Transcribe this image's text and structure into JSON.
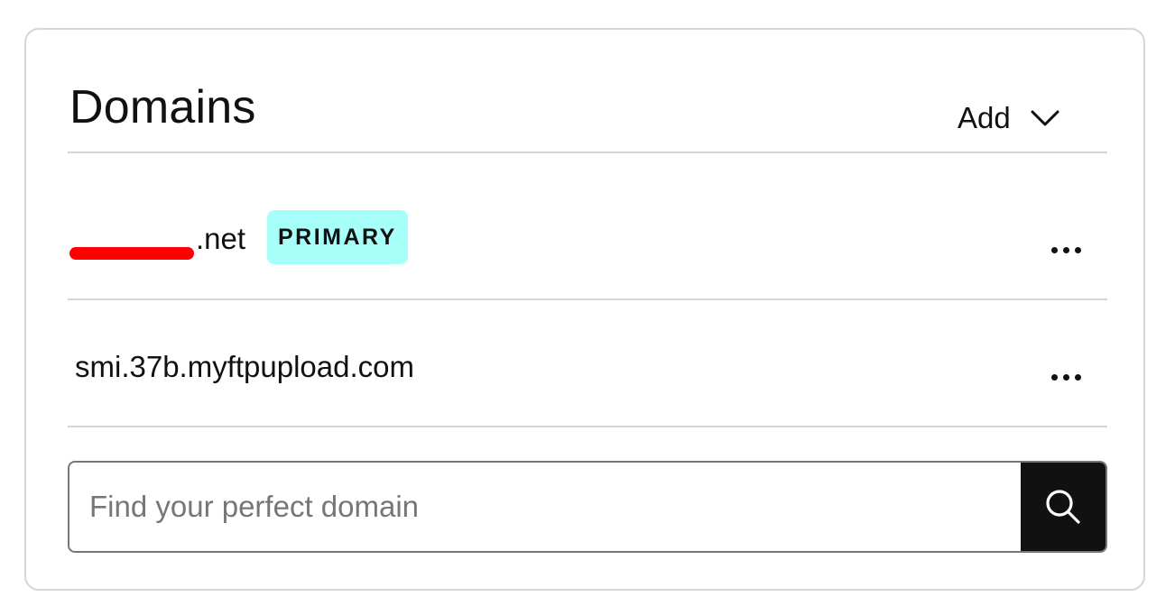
{
  "card": {
    "title": "Domains",
    "add": {
      "label": "Add",
      "icon": "chevron-down-icon"
    }
  },
  "domains": [
    {
      "name": ".net",
      "badge": "PRIMARY",
      "redacted": true,
      "menu_icon": "more-horizontal-icon"
    },
    {
      "name": "smi.37b.myftpupload.com",
      "menu_icon": "more-horizontal-icon"
    }
  ],
  "search": {
    "placeholder": "Find your perfect domain",
    "value": "",
    "button_icon": "search-icon"
  },
  "colors": {
    "badge_bg": "#a6fff8",
    "search_button_bg": "#111111",
    "redaction": "#ff0000",
    "border": "#d6d6d6"
  }
}
